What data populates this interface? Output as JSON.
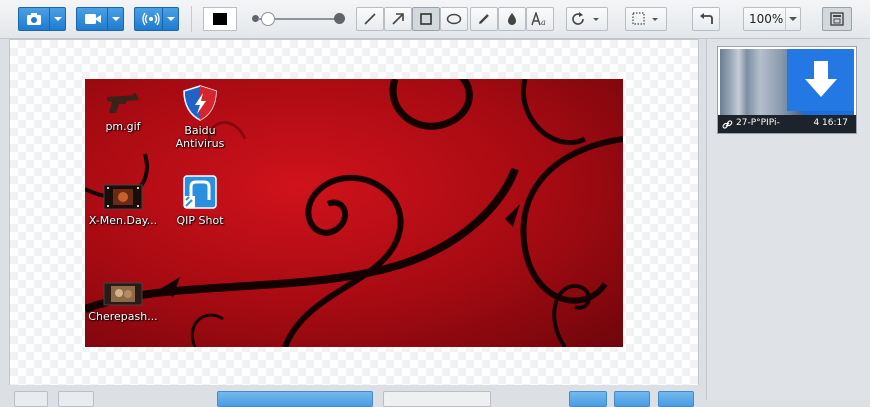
{
  "toolbar": {
    "zoom_value": "100%"
  },
  "desktop_icons": [
    {
      "label": "pm.gif"
    },
    {
      "label": "Baidu"
    },
    {
      "label": "Antivirus"
    },
    {
      "label": "X-Men.Day..."
    },
    {
      "label": "QIP Shot"
    },
    {
      "label": "Cherepash..."
    }
  ],
  "history": {
    "items": [
      {
        "name": "27-P°PIPi-",
        "time": "4 16:17"
      }
    ]
  },
  "colors": {
    "accent": "#1f7bd0",
    "current_draw_color": "#000000",
    "desktop_red": "#b00a14"
  }
}
